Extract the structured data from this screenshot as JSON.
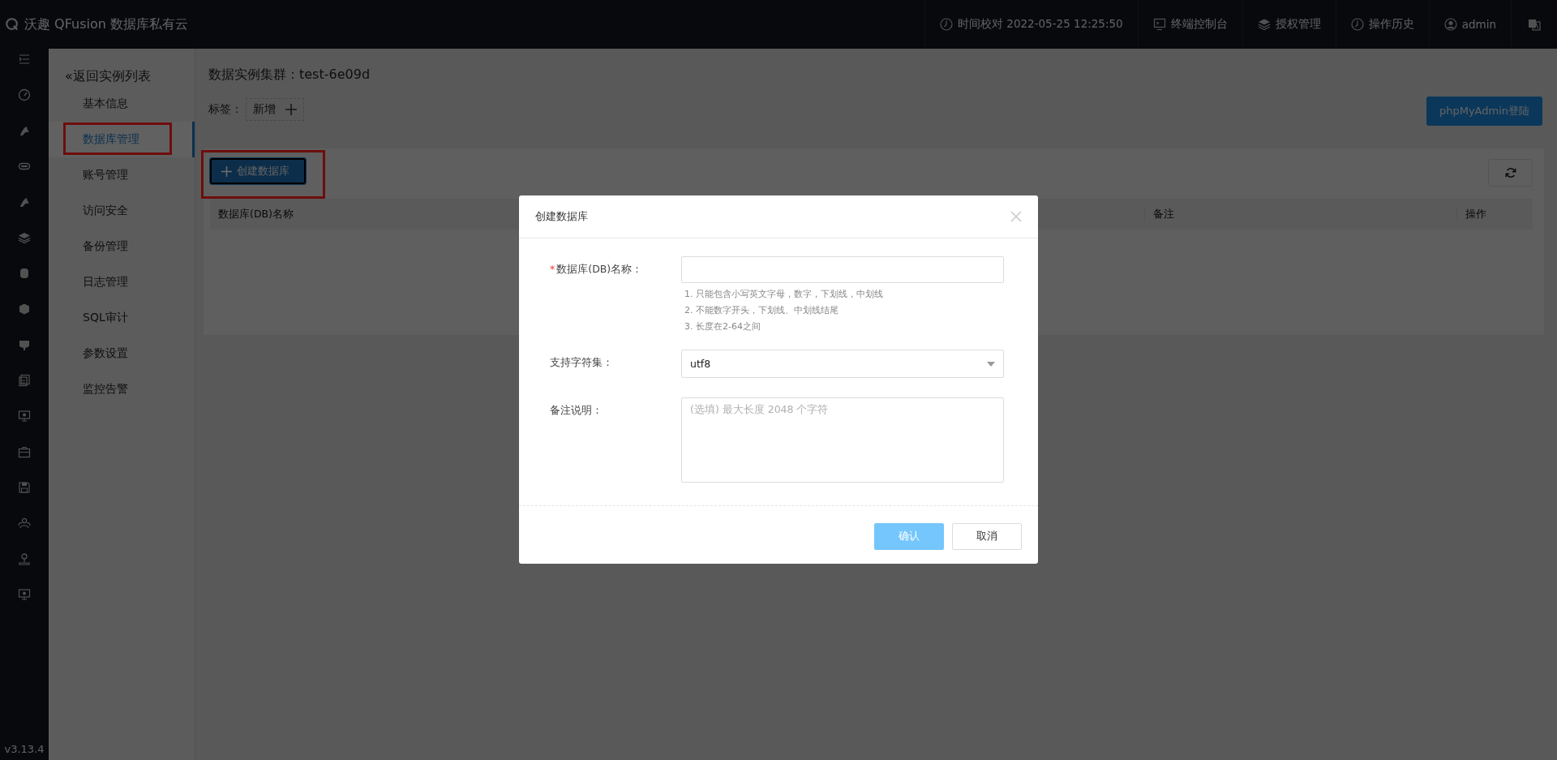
{
  "header": {
    "brand": "沃趣 QFusion 数据库私有云",
    "items": [
      {
        "kind": "clock",
        "label": "时间校对 2022-05-25 12:25:50"
      },
      {
        "kind": "terminal",
        "label": "终端控制台"
      },
      {
        "kind": "layers",
        "label": "授权管理"
      },
      {
        "kind": "clock",
        "label": "操作历史"
      },
      {
        "kind": "user",
        "label": "admin"
      }
    ]
  },
  "version": "v3.13.4",
  "nav": {
    "back": "«返回实例列表",
    "items": [
      {
        "label": "基本信息",
        "selected": false,
        "highlighted": false
      },
      {
        "label": "数据库管理",
        "selected": true,
        "highlighted": true
      },
      {
        "label": "账号管理",
        "selected": false,
        "highlighted": false
      },
      {
        "label": "访问安全",
        "selected": false,
        "highlighted": false
      },
      {
        "label": "备份管理",
        "selected": false,
        "highlighted": false
      },
      {
        "label": "日志管理",
        "selected": false,
        "highlighted": false
      },
      {
        "label": "SQL审计",
        "selected": false,
        "highlighted": false
      },
      {
        "label": "参数设置",
        "selected": false,
        "highlighted": false
      },
      {
        "label": "监控告警",
        "selected": false,
        "highlighted": false
      }
    ]
  },
  "page": {
    "title": "数据实例集群：test-6e09d",
    "tag_label": "标签：",
    "tag_add": "新增",
    "login_button": "phpMyAdmin登陆"
  },
  "toolbar": {
    "create_button": {
      "label": "创建数据库",
      "highlighted": true
    }
  },
  "table": {
    "columns": [
      "数据库(DB)名称",
      "备注",
      "操作"
    ]
  },
  "dialog": {
    "title": "创建数据库",
    "fields": [
      {
        "kind": "text",
        "required_mark": "*",
        "label": "数据库(DB)名称：",
        "hints": [
          "1. 只能包含小写英文字母，数字，下划线，中划线",
          "2. 不能数字开头，下划线、中划线结尾",
          "3. 长度在2-64之间"
        ]
      },
      {
        "kind": "select",
        "label": "支持字符集：",
        "value": "utf8"
      },
      {
        "kind": "textarea",
        "label": "备注说明：",
        "placeholder": "(选填) 最大长度 2048 个字符"
      }
    ],
    "buttons": [
      {
        "kind": "primary",
        "label": "确认"
      },
      {
        "kind": "default",
        "label": "取消"
      }
    ]
  }
}
